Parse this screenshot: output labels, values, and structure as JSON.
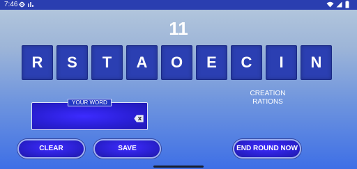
{
  "status_bar": {
    "time": "7:46",
    "icons": [
      "settings-gear-icon",
      "signal-alt-icon",
      "wifi-icon",
      "cell-signal-icon",
      "battery-icon"
    ]
  },
  "game": {
    "score": "11",
    "tiles": [
      "R",
      "S",
      "T",
      "A",
      "O",
      "E",
      "C",
      "I",
      "N"
    ],
    "found_words": [
      "CREATION",
      "RATIONS"
    ],
    "word_box_label": "YOUR WORD",
    "current_word": ""
  },
  "buttons": {
    "clear": "CLEAR",
    "save": "SAVE",
    "end_round": "END ROUND NOW"
  },
  "colors": {
    "status_bar": "#2a3eb0",
    "tile": "#2b3fb2",
    "button": "#2a20d0"
  }
}
